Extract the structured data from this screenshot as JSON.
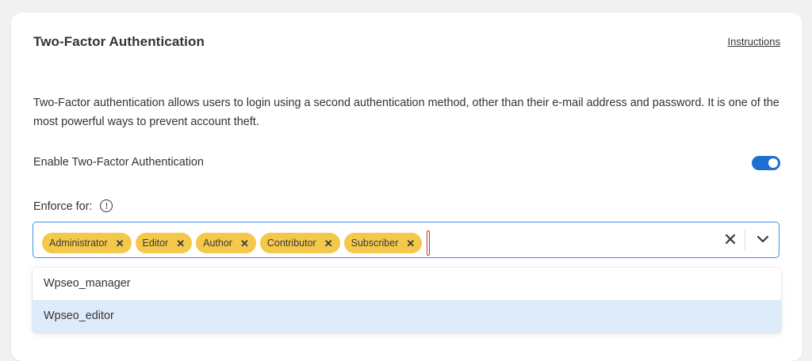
{
  "panel": {
    "title": "Two-Factor Authentication",
    "instructions_link": "Instructions",
    "description": "Two-Factor authentication allows users to login using a second authentication method, other than their e-mail address and password. It is one of the most powerful ways to prevent account theft."
  },
  "enable_setting": {
    "label": "Enable Two-Factor Authentication",
    "enabled": true
  },
  "enforce": {
    "label": "Enforce for:",
    "selected_roles": [
      {
        "label": "Administrator"
      },
      {
        "label": "Editor"
      },
      {
        "label": "Author"
      },
      {
        "label": "Contributor"
      },
      {
        "label": "Subscriber"
      }
    ],
    "dropdown_options": [
      {
        "label": "Wpseo_manager",
        "highlighted": false
      },
      {
        "label": "Wpseo_editor",
        "highlighted": true
      }
    ]
  },
  "icons": {
    "info": "info-circle-icon",
    "chip_remove": "close-icon",
    "clear": "clear-icon",
    "expand": "chevron-down-icon"
  },
  "colors": {
    "accent": "#1e6fd0",
    "chip": "#f4c84a",
    "highlight": "#deebfb",
    "focus_border": "#3b8ee6"
  }
}
